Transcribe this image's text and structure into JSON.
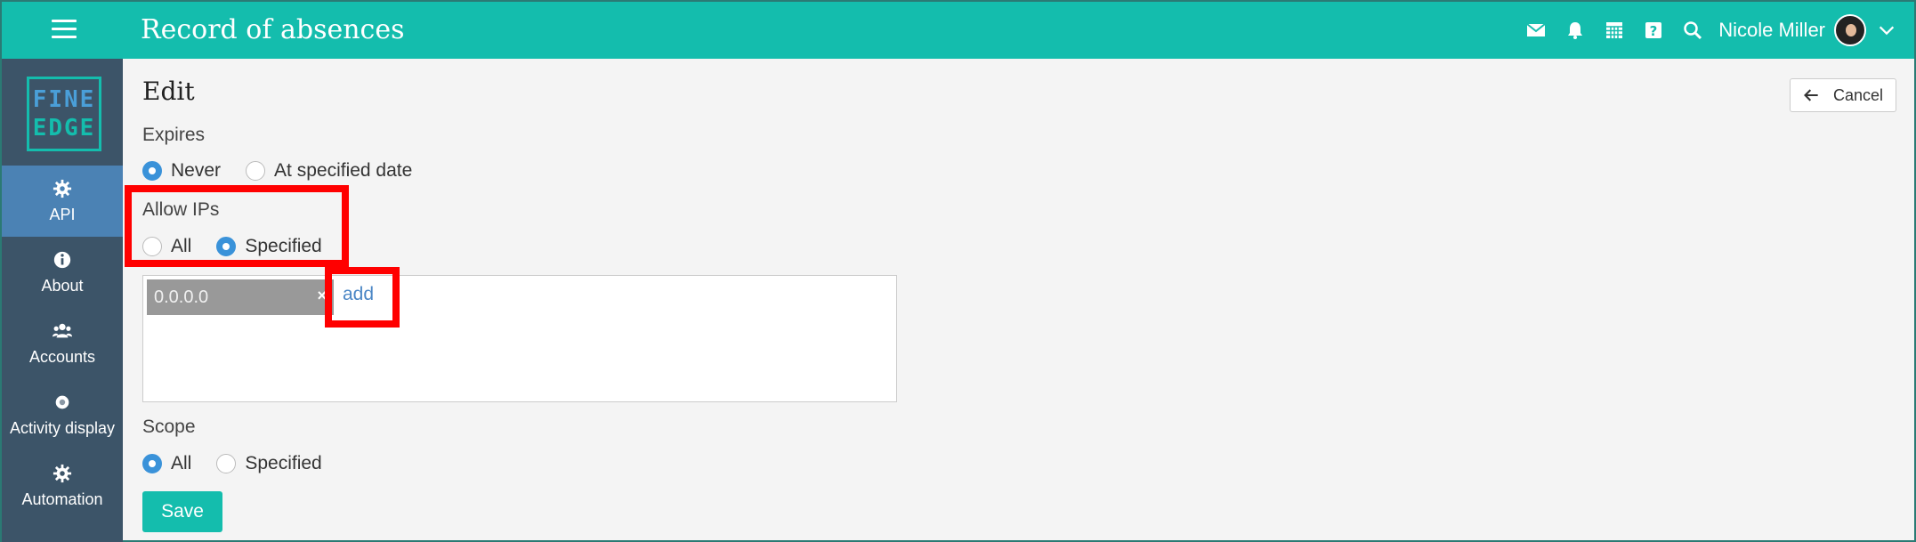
{
  "header": {
    "title": "Record of absences",
    "user_name": "Nicole Miller",
    "icons": [
      "mail-icon",
      "bell-icon",
      "calendar-icon",
      "help-icon",
      "search-icon"
    ]
  },
  "sidebar": {
    "logo_line1": "FINE",
    "logo_line2": "EDGE",
    "items": [
      {
        "label": "API",
        "icon": "gear-icon",
        "active": true
      },
      {
        "label": "About",
        "icon": "info-icon"
      },
      {
        "label": "Accounts",
        "icon": "users-icon"
      },
      {
        "label": "Activity display",
        "icon": "dot-icon"
      },
      {
        "label": "Automation",
        "icon": "gear-icon"
      }
    ]
  },
  "main": {
    "title": "Edit",
    "cancel_label": "Cancel",
    "expires": {
      "label": "Expires",
      "options": [
        "Never",
        "At specified date"
      ],
      "selected": "Never"
    },
    "allow_ips": {
      "label": "Allow IPs",
      "options": [
        "All",
        "Specified"
      ],
      "selected": "Specified",
      "tags": [
        "0.0.0.0"
      ],
      "add_label": "add"
    },
    "scope": {
      "label": "Scope",
      "options": [
        "All",
        "Specified"
      ],
      "selected": "All"
    },
    "save_label": "Save"
  },
  "colors": {
    "header": "#14bdad",
    "sidebar": "#3c5468",
    "sidebar_active": "#4b82b4",
    "radio_checked": "#3a92d9",
    "highlight": "#ff0000"
  }
}
